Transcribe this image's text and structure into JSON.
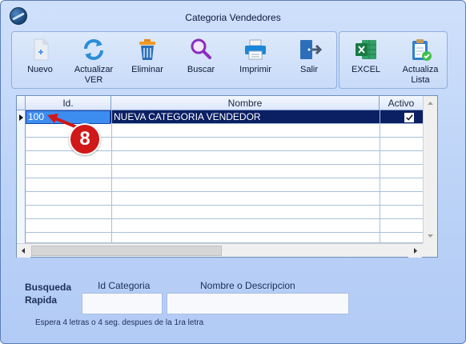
{
  "window": {
    "title": "Categoria Vendedores"
  },
  "toolbar": {
    "buttons": [
      {
        "label": "Nuevo",
        "icon": "new-document-icon"
      },
      {
        "label": "Actualizar VER",
        "icon": "refresh-icon"
      },
      {
        "label": "Eliminar",
        "icon": "trash-icon"
      },
      {
        "label": "Buscar",
        "icon": "magnifier-icon"
      },
      {
        "label": "Imprimir",
        "icon": "printer-icon"
      },
      {
        "label": "Salir",
        "icon": "exit-icon"
      }
    ],
    "export_buttons": [
      {
        "label": "EXCEL",
        "icon": "excel-icon"
      },
      {
        "label": "Actualiza Lista",
        "icon": "clipboard-check-icon"
      }
    ]
  },
  "grid": {
    "columns": [
      "Id.",
      "Nombre",
      "Activo"
    ],
    "rows": [
      {
        "id": "100",
        "nombre": "NUEVA CATEGORIA VENDEDOR",
        "activo": true
      }
    ]
  },
  "annotation": {
    "badge": "8"
  },
  "search": {
    "title_line1": "Busqueda",
    "title_line2": "Rapida",
    "id_label": "Id Categoria",
    "name_label": "Nombre o Descripcion",
    "id_value": "",
    "name_value": "",
    "hint": "Espera 4 letras o 4 seg. despues de la 1ra letra"
  },
  "colors": {
    "selected_row": "#0b1f63",
    "selected_cell": "#3d8df0",
    "badge": "#d01818"
  }
}
